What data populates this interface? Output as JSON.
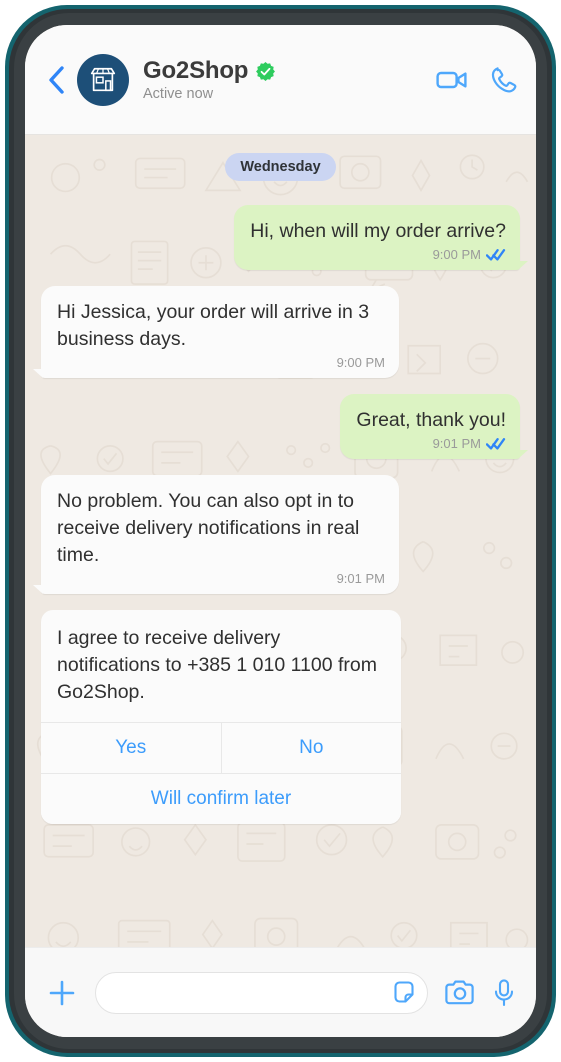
{
  "header": {
    "back_icon": "chevron-left-icon",
    "avatar_icon": "storefront-icon",
    "contact_name": "Go2Shop",
    "verified_icon": "verified-badge-icon",
    "status": "Active now",
    "video_icon": "video-call-icon",
    "call_icon": "phone-call-icon"
  },
  "conversation": {
    "date_divider": "Wednesday",
    "messages": [
      {
        "direction": "out",
        "text": "Hi, when will my order arrive?",
        "time": "9:00 PM",
        "status_icon": "double-check-read-icon"
      },
      {
        "direction": "in",
        "text": "Hi Jessica, your order will arrive in 3 business days.",
        "time": "9:00 PM",
        "status_icon": ""
      },
      {
        "direction": "out",
        "text": "Great, thank you!",
        "time": "9:01 PM",
        "status_icon": "double-check-read-icon"
      },
      {
        "direction": "in",
        "text": "No problem. You can also opt in to receive delivery notifications in real time.",
        "time": "9:01 PM",
        "status_icon": ""
      }
    ],
    "opt_in_card": {
      "text": "I agree to receive delivery notifications to +385 1 010 1100 from Go2Shop.",
      "buttons": [
        {
          "label": "Yes"
        },
        {
          "label": "No"
        }
      ],
      "secondary_button": {
        "label": "Will confirm later"
      }
    }
  },
  "composer": {
    "plus_icon": "plus-icon",
    "input_value": "",
    "input_placeholder": "",
    "sticker_icon": "sticker-icon",
    "camera_icon": "camera-icon",
    "mic_icon": "microphone-icon"
  },
  "colors": {
    "accent_blue": "#3c9cfb",
    "outgoing_bubble": "#DCF3C3",
    "incoming_bubble": "#FBFBFB",
    "chat_background": "#EFE9E2",
    "date_chip": "#CBD5F2",
    "verified_green": "#2ecc5e",
    "avatar_navy": "#1d4f78",
    "bezel_teal": "#14646e"
  }
}
